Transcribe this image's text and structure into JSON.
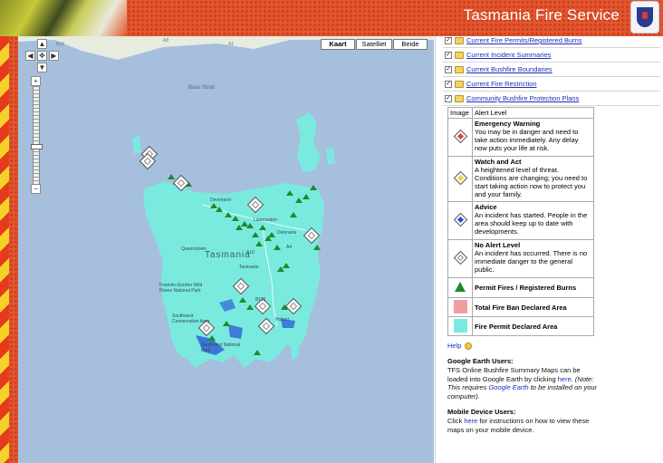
{
  "header": {
    "title": "Tasmania Fire Service"
  },
  "map": {
    "map_types": [
      "Kaart",
      "Satelliet",
      "Beide"
    ],
    "active_map_type": "Kaart",
    "labels": {
      "bass_strait": "Bass Strait",
      "tasmania": "Tasmania",
      "tasmania_sub": "Tasmania",
      "park1": "Franklin-Gordon Wild Rivers National Park",
      "park2": "Southwest Conservation Area",
      "park3": "Southwest National Park",
      "road_b18": "B18",
      "road_a1": "A1",
      "road_a8": "A8",
      "road_a4": "A4",
      "road_a10": "A10",
      "road_b110": "B110",
      "city_devonport": "Devonport",
      "city_launceston": "Launceston",
      "city_deloraine": "Deloraine",
      "city_hobart": "Hobart",
      "city_queenstown": "Queenstown"
    },
    "colors": {
      "water": "#a5bfdd",
      "fire_permit_area": "#7aeadf",
      "total_fire_ban": "#f09ea4",
      "permit_fire": "#1f8a2b"
    }
  },
  "layers": [
    {
      "label": "Current Fire Permits/Registered Burns",
      "checked": true
    },
    {
      "label": "Current Incident Summaries",
      "checked": true
    },
    {
      "label": "Current Bushfire Boundaries",
      "checked": true
    },
    {
      "label": "Current Fire Restriction",
      "checked": true
    },
    {
      "label": "Community Bushfire Protection Plans",
      "checked": true
    }
  ],
  "alert_table": {
    "col_image": "Image",
    "col_alert": "Alert Level",
    "rows": [
      {
        "title": "Emergency Warning",
        "text": "You may be in danger and need to take action immediately. Any delay now puts your life at risk.",
        "icon": "emergency-diamond-icon",
        "color": "#e6432a"
      },
      {
        "title": "Watch and Act",
        "text": "A heightened level of threat. Conditions are changing; you need to start taking action now to protect you and your family.",
        "icon": "watch-act-diamond-icon",
        "color": "#e5d93a"
      },
      {
        "title": "Advice",
        "text": "An incident has started. People in the area should keep up to date with developments.",
        "icon": "advice-diamond-icon",
        "color": "#2a4fd6"
      },
      {
        "title": "No Alert Level",
        "text": "An incident has occurred. There is no immediate danger to the general public.",
        "icon": "no-alert-diamond-icon",
        "color": "#ffffff"
      }
    ],
    "legend": [
      {
        "title": "Permit Fires / Registered Burns",
        "icon": "permit-triangle-icon"
      },
      {
        "title": "Total Fire Ban Declared Area",
        "icon": "fire-ban-swatch-icon"
      },
      {
        "title": "Fire Permit Declared Area",
        "icon": "permit-area-swatch-icon"
      }
    ]
  },
  "help": {
    "label": "Help"
  },
  "google_earth": {
    "title": "Google Earth Users:",
    "text1": "TFS Online Bushfire Summary Maps can be loaded into Google Earth by clicking ",
    "link_here": "here",
    "text2": ". (Note: This requires ",
    "link_ge": "Google Earth",
    "text3": " to be installed on your computer)."
  },
  "mobile": {
    "title": "Mobile Device Users:",
    "text1": "Click ",
    "link_here": "here",
    "text2": " for instructions on how to view these maps on your mobile device."
  }
}
